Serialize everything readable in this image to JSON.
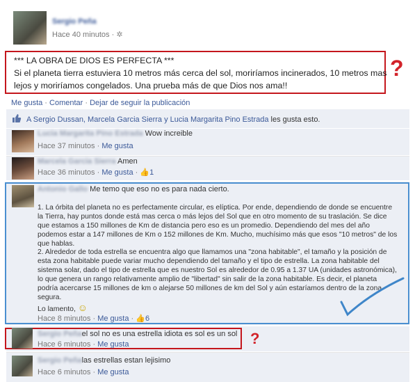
{
  "post": {
    "author": "Sergio Peña",
    "time": "Hace 40 minutos",
    "privacy_icon": "gear-icon",
    "title_line": "*** LA OBRA DE DIOS ES PERFECTA ***",
    "body_line1": "Si el planeta tierra estuviera 10 metros más cerca del sol, moriríamos incinerados, 10 metros mas",
    "body_line2": "lejos y moriríamos congelados. Una prueba más de que Dios nos ama!!",
    "question_mark": "?"
  },
  "actions": {
    "like": "Me gusta",
    "dot1": " · ",
    "comment": "Comentar",
    "dot2": " · ",
    "unfollow": "Dejar de seguir la publicación"
  },
  "likes": {
    "names": "A Sergio Dussan, Marcela Garcia Sierra y Lucia Margarita Pino Estrada",
    "suffix": " les gusta esto."
  },
  "comments": [
    {
      "name": "Lucia Margarita Pino Estrada",
      "text": "Wow increible",
      "time": "Hace 37 minutos",
      "like": "Me gusta"
    },
    {
      "name": "Marcela Garcia Sierra",
      "text": "Amen",
      "time": "Hace 36 minutos",
      "like": "Me gusta",
      "likes": "1"
    },
    {
      "name": "Antonio Gallo",
      "text": "Me temo que eso no es para nada cierto.",
      "p1": "1. La órbita del planeta no es perfectamente circular, es elíptica. Por ende, dependiendo de donde se encuentre la Tierra, hay puntos donde está mas cerca o más lejos del Sol que en otro momento de su traslación. Se dice que estamos a 150 millones de Km de distancia pero eso es un promedio. Dependiendo del mes del año podemos estar a 147 millones de Km o 152 millones de Km. Mucho, muchísimo más que esos \"10 metros\" de los que hablas.",
      "p2": "2. Alrededor de toda estrella se encuentra algo que llamamos una \"zona habitable\", el tamaño y la posición de esta zona habitable puede variar mucho dependiendo del tamaño y el tipo de estrella. La zona habitable del sistema solar, dado el tipo de estrella que es nuestro Sol es alrededor de 0.95 a 1.37 UA (unidades astronómica), lo que genera un rango relativamente amplio de \"libertad\" sin salir de la zona habitable. Es decir, el planeta podría acercarse 15 millones de km o alejarse 50 millones de km del Sol y aún estaríamos dentro de la zona segura.",
      "closing": "Lo lamento,",
      "smiley": "☺",
      "time": "Hace 8 minutos",
      "like": "Me gusta",
      "likes": "6"
    },
    {
      "name": "Sergio Peña",
      "text": "el sol no es una estrella idiota es sol es un sol",
      "time": "Hace 6 minutos",
      "like": "Me gusta",
      "question_mark": "?"
    },
    {
      "name": "Sergio Peña",
      "text": "las estrellas estan lejisimo",
      "time": "Hace 6 minutos",
      "like": "Me gusta"
    }
  ],
  "colors": {
    "link": "#3b5998",
    "highlight_red": "#c4161c",
    "highlight_blue": "#4a8fd0",
    "comment_bg": "#eceff5"
  }
}
